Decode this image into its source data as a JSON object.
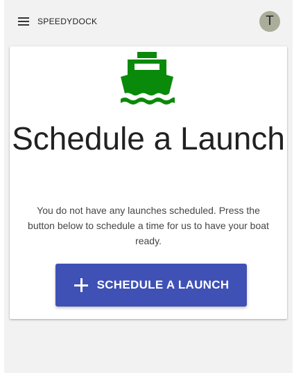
{
  "appbar": {
    "title": "SPEEDYDOCK",
    "menu_icon": "menu-icon",
    "avatar_letter": "T"
  },
  "main": {
    "icon": "directions-boat-icon",
    "heading": "Schedule a Launch",
    "description": "You do not have any launches scheduled. Press the button below to schedule a time for us to have your boat ready.",
    "button_label": "SCHEDULE A LAUNCH",
    "button_icon": "plus-icon"
  },
  "colors": {
    "brand_green": "#0a8a0a",
    "button_blue": "#3f51b5",
    "avatar_bg": "#a9ad99"
  }
}
